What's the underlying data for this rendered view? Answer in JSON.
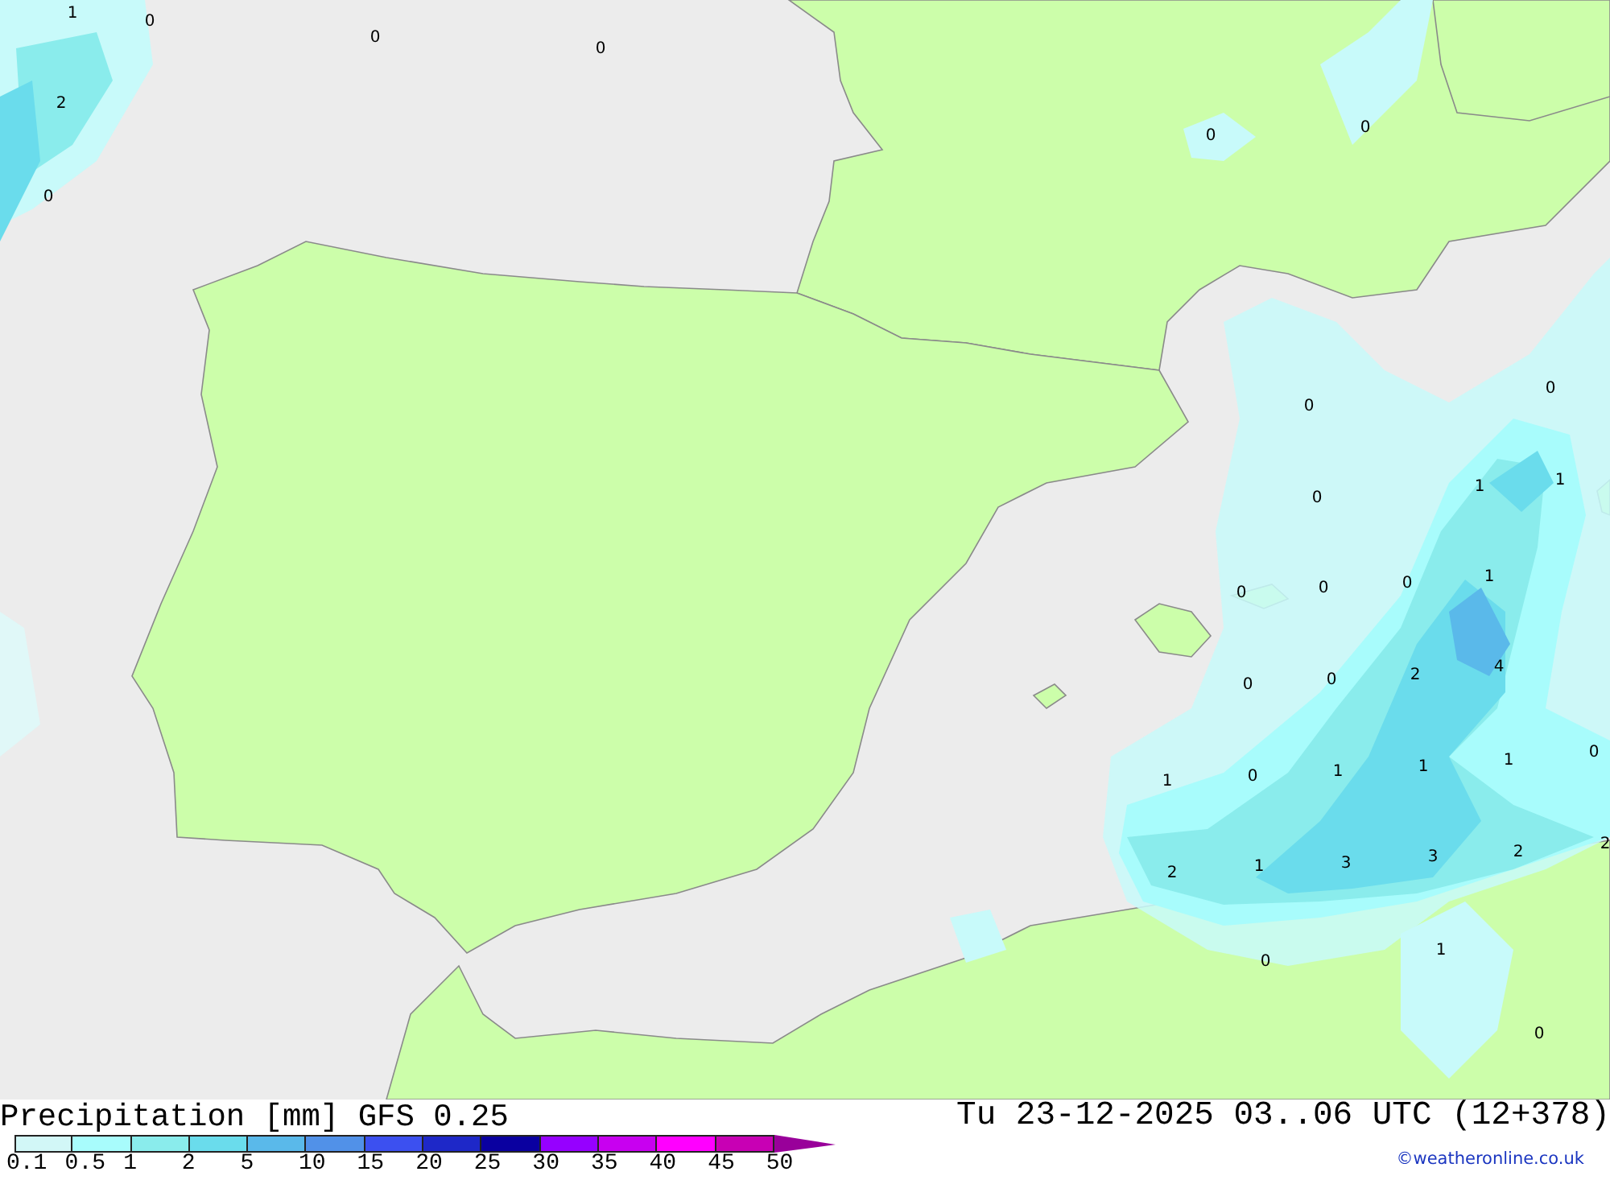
{
  "map": {
    "value_labels": [
      "1",
      "0",
      "0",
      "0",
      "2",
      "0",
      "0",
      "0",
      "0",
      "0",
      "1",
      "1",
      "0",
      "0",
      "0",
      "0",
      "1",
      "2",
      "4",
      "0",
      "0",
      "0",
      "1",
      "0",
      "1",
      "1",
      "1",
      "2",
      "1",
      "3",
      "3",
      "2",
      "2",
      "1",
      "0",
      "0"
    ]
  },
  "footer": {
    "title": "Precipitation [mm] GFS 0.25",
    "datetime": "Tu 23-12-2025 03..06 UTC (12+378)",
    "credit": "©weatheronline.co.uk"
  },
  "legend": {
    "bins": [
      {
        "color": "#d2f7f7"
      },
      {
        "color": "#a8fcfc"
      },
      {
        "color": "#8aecec"
      },
      {
        "color": "#6adcec"
      },
      {
        "color": "#5ab9ea"
      },
      {
        "color": "#5191e8"
      },
      {
        "color": "#3c50f0"
      },
      {
        "color": "#1e28c8"
      },
      {
        "color": "#0a00a0"
      },
      {
        "color": "#9600ff"
      },
      {
        "color": "#c800f0"
      },
      {
        "color": "#ff00ff"
      },
      {
        "color": "#c800b4"
      }
    ],
    "labels": [
      "0.1",
      "0.5",
      "1",
      "2",
      "5",
      "10",
      "15",
      "20",
      "25",
      "30",
      "35",
      "40",
      "45",
      "50"
    ]
  }
}
